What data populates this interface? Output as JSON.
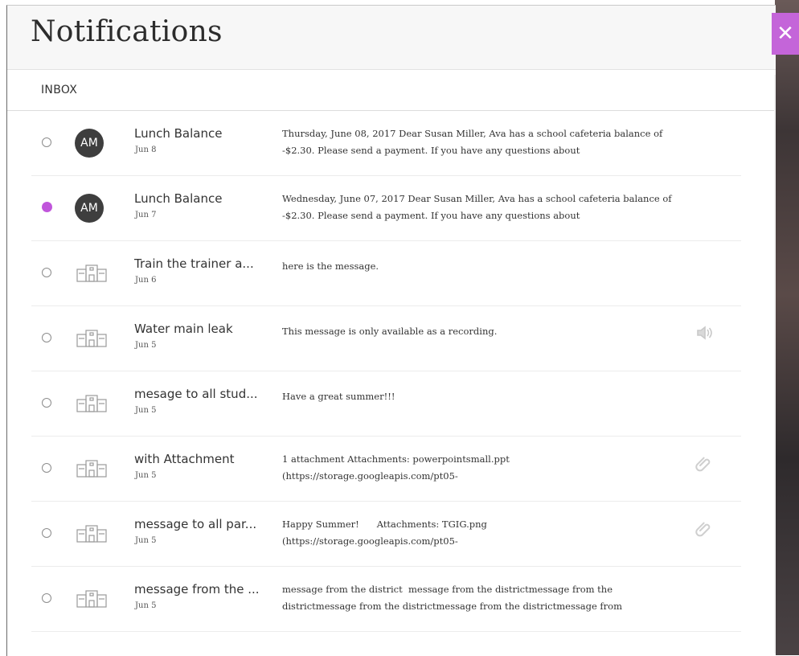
{
  "header": {
    "title": "Notifications",
    "close_label": "✕"
  },
  "inbox": {
    "label": "INBOX"
  },
  "colors": {
    "accent": "#c465d9",
    "unread_dot": "#c055db",
    "avatar_bg": "#3e3e3e"
  },
  "messages": [
    {
      "subject": "Lunch Balance",
      "date": "Jun 8",
      "preview": "Thursday, June 08, 2017 Dear Susan Miller, Ava has a school cafeteria balance of -$2.30. Please send a payment. If you have any questions about",
      "sender_type": "avatar",
      "avatar_initials": "AM",
      "unread": false,
      "side_icon": ""
    },
    {
      "subject": "Lunch Balance",
      "date": "Jun 7",
      "preview": "Wednesday, June 07, 2017 Dear Susan Miller, Ava has a school cafeteria balance of -$2.30. Please send a payment. If you have any questions about",
      "sender_type": "avatar",
      "avatar_initials": "AM",
      "unread": true,
      "side_icon": ""
    },
    {
      "subject": "Train the trainer a...",
      "date": "Jun 6",
      "preview": "here is the message.",
      "sender_type": "school",
      "unread": false,
      "side_icon": ""
    },
    {
      "subject": "Water main leak",
      "date": "Jun 5",
      "preview": "This message is only available as a recording.",
      "sender_type": "school",
      "unread": false,
      "side_icon": "speaker-icon"
    },
    {
      "subject": "mesage to all stud...",
      "date": "Jun 5",
      "preview": "Have a great summer!!!",
      "sender_type": "school",
      "unread": false,
      "side_icon": ""
    },
    {
      "subject": "with Attachment",
      "date": "Jun 5",
      "preview": "1 attachment Attachments: powerpointsmall.ppt\n(https://storage.googleapis.com/pt05-",
      "sender_type": "school",
      "unread": false,
      "side_icon": "paperclip-icon"
    },
    {
      "subject": "message to all par...",
      "date": "Jun 5",
      "preview": "Happy Summer!      Attachments: TGIG.png\n(https://storage.googleapis.com/pt05-",
      "sender_type": "school",
      "unread": false,
      "side_icon": "paperclip-icon"
    },
    {
      "subject": "message from the ...",
      "date": "Jun 5",
      "preview": "message from the district  message from the districtmessage from the districtmessage from the districtmessage from the districtmessage from",
      "sender_type": "school",
      "unread": false,
      "side_icon": ""
    }
  ]
}
